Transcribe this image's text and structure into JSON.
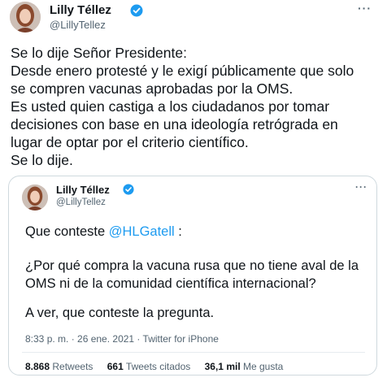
{
  "tweet": {
    "author_name": "Lilly Téllez",
    "author_handle": "@LillyTellez",
    "lines": [
      "Se lo dije Señor Presidente:",
      "Desde enero protesté y le exigí públicamente que solo",
      "se compren  vacunas aprobadas por la OMS.",
      "Es usted quien castiga a los ciudadanos por tomar",
      "decisiones con base en una ideología retrógrada en",
      "lugar de optar por el criterio científico.",
      "Se lo dije."
    ]
  },
  "quoted": {
    "author_name": "Lilly Téllez",
    "author_handle": "@LillyTellez",
    "intro_text": "Que conteste ",
    "mention": "@HLGatell",
    "intro_suffix": " :",
    "question_line1": "¿Por qué compra la vacuna rusa que no tiene aval de la",
    "question_line2": "OMS ni de la comunidad científica internacional?",
    "closing": "A ver, que conteste la pregunta.",
    "timestamp": "8:33 p. m. · 26 ene. 2021 · Twitter for iPhone",
    "retweets_count": "8.868",
    "retweets_label": "Retweets",
    "quotes_count": "661",
    "quotes_label": "Tweets citados",
    "likes_count": "36,1 mil",
    "likes_label": "Me gusta"
  },
  "colors": {
    "verified": "#1d9bf0",
    "mention": "#1d9bf0"
  },
  "icons": {
    "verified": "verified-badge-icon",
    "more": "more-options-icon"
  }
}
